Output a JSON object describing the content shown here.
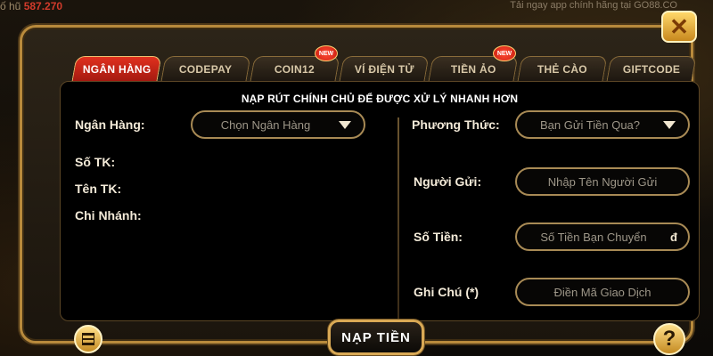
{
  "background": {
    "top_left_label": "ố hũ",
    "top_left_value": "587.270",
    "top_right_text": "Tải ngay app chính hãng tại GO88.CO"
  },
  "colors": {
    "active_tab": "#d8261a",
    "gold_border": "#b88a3c",
    "panel_bg": "#000000"
  },
  "close_icon": "close-icon",
  "tabs": [
    {
      "label": "NGÂN HÀNG",
      "active": true,
      "new": false
    },
    {
      "label": "CODEPAY",
      "active": false,
      "new": false
    },
    {
      "label": "COIN12",
      "active": false,
      "new": true
    },
    {
      "label": "VÍ ĐIỆN TỬ",
      "active": false,
      "new": false
    },
    {
      "label": "TIỀN ẢO",
      "active": false,
      "new": true
    },
    {
      "label": "THẺ CÀO",
      "active": false,
      "new": false
    },
    {
      "label": "GIFTCODE",
      "active": false,
      "new": false
    }
  ],
  "badge_new": "NEW",
  "heading": "NẠP RÚT CHÍNH CHỦ ĐỂ ĐƯỢC XỬ LÝ NHANH HƠN",
  "left": {
    "bank_label": "Ngân Hàng:",
    "bank_placeholder": "Chọn Ngân Hàng",
    "account_no_label": "Số TK:",
    "account_name_label": "Tên TK:",
    "branch_label": "Chi Nhánh:"
  },
  "right": {
    "method_label": "Phương Thức:",
    "method_placeholder": "Bạn Gửi Tiền Qua?",
    "sender_label": "Người Gửi:",
    "sender_placeholder": "Nhập Tên Người Gửi",
    "amount_label": "Số Tiền:",
    "amount_placeholder": "Số Tiền Bạn Chuyển",
    "currency": "đ",
    "note_label": "Ghi Chú (*)",
    "note_placeholder": "Điền Mã Giao Dịch"
  },
  "submit_label": "NẠP TIỀN",
  "close_label": "✕",
  "help_label": "?"
}
